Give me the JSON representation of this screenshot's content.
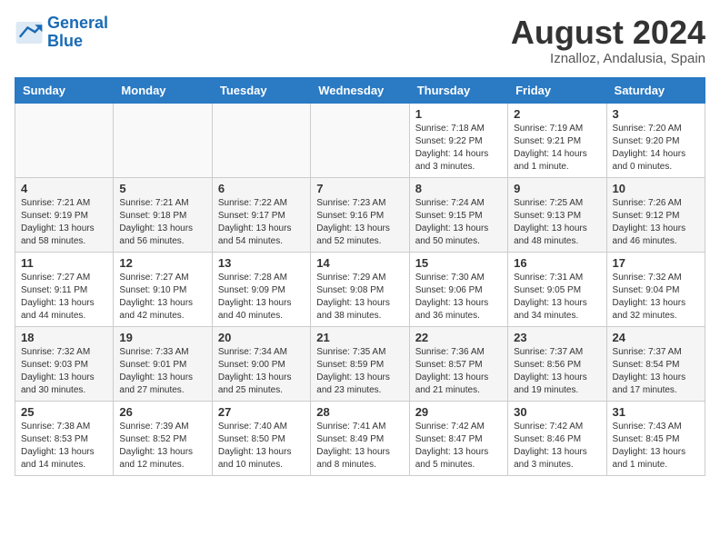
{
  "logo": {
    "line1": "General",
    "line2": "Blue"
  },
  "title": "August 2024",
  "location": "Iznalloz, Andalusia, Spain",
  "weekdays": [
    "Sunday",
    "Monday",
    "Tuesday",
    "Wednesday",
    "Thursday",
    "Friday",
    "Saturday"
  ],
  "weeks": [
    [
      {
        "day": "",
        "info": ""
      },
      {
        "day": "",
        "info": ""
      },
      {
        "day": "",
        "info": ""
      },
      {
        "day": "",
        "info": ""
      },
      {
        "day": "1",
        "info": "Sunrise: 7:18 AM\nSunset: 9:22 PM\nDaylight: 14 hours\nand 3 minutes."
      },
      {
        "day": "2",
        "info": "Sunrise: 7:19 AM\nSunset: 9:21 PM\nDaylight: 14 hours\nand 1 minute."
      },
      {
        "day": "3",
        "info": "Sunrise: 7:20 AM\nSunset: 9:20 PM\nDaylight: 14 hours\nand 0 minutes."
      }
    ],
    [
      {
        "day": "4",
        "info": "Sunrise: 7:21 AM\nSunset: 9:19 PM\nDaylight: 13 hours\nand 58 minutes."
      },
      {
        "day": "5",
        "info": "Sunrise: 7:21 AM\nSunset: 9:18 PM\nDaylight: 13 hours\nand 56 minutes."
      },
      {
        "day": "6",
        "info": "Sunrise: 7:22 AM\nSunset: 9:17 PM\nDaylight: 13 hours\nand 54 minutes."
      },
      {
        "day": "7",
        "info": "Sunrise: 7:23 AM\nSunset: 9:16 PM\nDaylight: 13 hours\nand 52 minutes."
      },
      {
        "day": "8",
        "info": "Sunrise: 7:24 AM\nSunset: 9:15 PM\nDaylight: 13 hours\nand 50 minutes."
      },
      {
        "day": "9",
        "info": "Sunrise: 7:25 AM\nSunset: 9:13 PM\nDaylight: 13 hours\nand 48 minutes."
      },
      {
        "day": "10",
        "info": "Sunrise: 7:26 AM\nSunset: 9:12 PM\nDaylight: 13 hours\nand 46 minutes."
      }
    ],
    [
      {
        "day": "11",
        "info": "Sunrise: 7:27 AM\nSunset: 9:11 PM\nDaylight: 13 hours\nand 44 minutes."
      },
      {
        "day": "12",
        "info": "Sunrise: 7:27 AM\nSunset: 9:10 PM\nDaylight: 13 hours\nand 42 minutes."
      },
      {
        "day": "13",
        "info": "Sunrise: 7:28 AM\nSunset: 9:09 PM\nDaylight: 13 hours\nand 40 minutes."
      },
      {
        "day": "14",
        "info": "Sunrise: 7:29 AM\nSunset: 9:08 PM\nDaylight: 13 hours\nand 38 minutes."
      },
      {
        "day": "15",
        "info": "Sunrise: 7:30 AM\nSunset: 9:06 PM\nDaylight: 13 hours\nand 36 minutes."
      },
      {
        "day": "16",
        "info": "Sunrise: 7:31 AM\nSunset: 9:05 PM\nDaylight: 13 hours\nand 34 minutes."
      },
      {
        "day": "17",
        "info": "Sunrise: 7:32 AM\nSunset: 9:04 PM\nDaylight: 13 hours\nand 32 minutes."
      }
    ],
    [
      {
        "day": "18",
        "info": "Sunrise: 7:32 AM\nSunset: 9:03 PM\nDaylight: 13 hours\nand 30 minutes."
      },
      {
        "day": "19",
        "info": "Sunrise: 7:33 AM\nSunset: 9:01 PM\nDaylight: 13 hours\nand 27 minutes."
      },
      {
        "day": "20",
        "info": "Sunrise: 7:34 AM\nSunset: 9:00 PM\nDaylight: 13 hours\nand 25 minutes."
      },
      {
        "day": "21",
        "info": "Sunrise: 7:35 AM\nSunset: 8:59 PM\nDaylight: 13 hours\nand 23 minutes."
      },
      {
        "day": "22",
        "info": "Sunrise: 7:36 AM\nSunset: 8:57 PM\nDaylight: 13 hours\nand 21 minutes."
      },
      {
        "day": "23",
        "info": "Sunrise: 7:37 AM\nSunset: 8:56 PM\nDaylight: 13 hours\nand 19 minutes."
      },
      {
        "day": "24",
        "info": "Sunrise: 7:37 AM\nSunset: 8:54 PM\nDaylight: 13 hours\nand 17 minutes."
      }
    ],
    [
      {
        "day": "25",
        "info": "Sunrise: 7:38 AM\nSunset: 8:53 PM\nDaylight: 13 hours\nand 14 minutes."
      },
      {
        "day": "26",
        "info": "Sunrise: 7:39 AM\nSunset: 8:52 PM\nDaylight: 13 hours\nand 12 minutes."
      },
      {
        "day": "27",
        "info": "Sunrise: 7:40 AM\nSunset: 8:50 PM\nDaylight: 13 hours\nand 10 minutes."
      },
      {
        "day": "28",
        "info": "Sunrise: 7:41 AM\nSunset: 8:49 PM\nDaylight: 13 hours\nand 8 minutes."
      },
      {
        "day": "29",
        "info": "Sunrise: 7:42 AM\nSunset: 8:47 PM\nDaylight: 13 hours\nand 5 minutes."
      },
      {
        "day": "30",
        "info": "Sunrise: 7:42 AM\nSunset: 8:46 PM\nDaylight: 13 hours\nand 3 minutes."
      },
      {
        "day": "31",
        "info": "Sunrise: 7:43 AM\nSunset: 8:45 PM\nDaylight: 13 hours\nand 1 minute."
      }
    ]
  ]
}
